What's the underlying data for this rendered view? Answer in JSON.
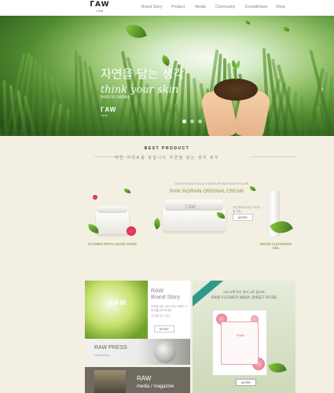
{
  "header": {
    "logo_top": "ᒥAW",
    "logo_bottom": "raw",
    "nav": [
      "Brand Story",
      "Product",
      "Media",
      "Community",
      "Event&News",
      "Shop"
    ]
  },
  "hero": {
    "title": "자연을 담는 생각",
    "subtitle": "think your skin",
    "tagline": "born to nature",
    "logo_top": "ᒥAW",
    "logo_bottom": "raw",
    "slide_count": 3,
    "active_slide": 1
  },
  "best_product": {
    "title": "BEST PRODUCT",
    "subtitle": "자연 그대로를 담습니다 자연을 담는 생각 로우",
    "products": [
      {
        "label": "FLOWER PETAL MASK ROSE"
      },
      {
        "small": "BRIGHTENING RITUALS WHEN SPRING ROSE IN GLOW",
        "title": "RAW INGRAIN ORIGINAL CREAM",
        "desc": "자연 원료로 만든 오리지널 크림",
        "button": "MORE"
      },
      {
        "label": "DRAW CLEANSING GEL"
      }
    ]
  },
  "promo": {
    "brand": {
      "logo": "ᒥAW",
      "logo_bottom": "raw",
      "title_line1": "RAW",
      "title_line2": "Brand Story",
      "desc": "자연을 담는 생각 로우 브랜드 스토리를 만나보세요",
      "note": "자연을 담는 생각",
      "button": "MORE"
    },
    "press": {
      "title": "RAW PRESS",
      "sub": "media press"
    },
    "media": {
      "title": "RAW",
      "sub": "media / magazine"
    },
    "mask": {
      "small": "마스크팩 로우 장미 시트 플라워",
      "title": "RAW FLOWER MASK SHEET ROSE",
      "pack_label": "RAW",
      "button": "MORE"
    }
  }
}
